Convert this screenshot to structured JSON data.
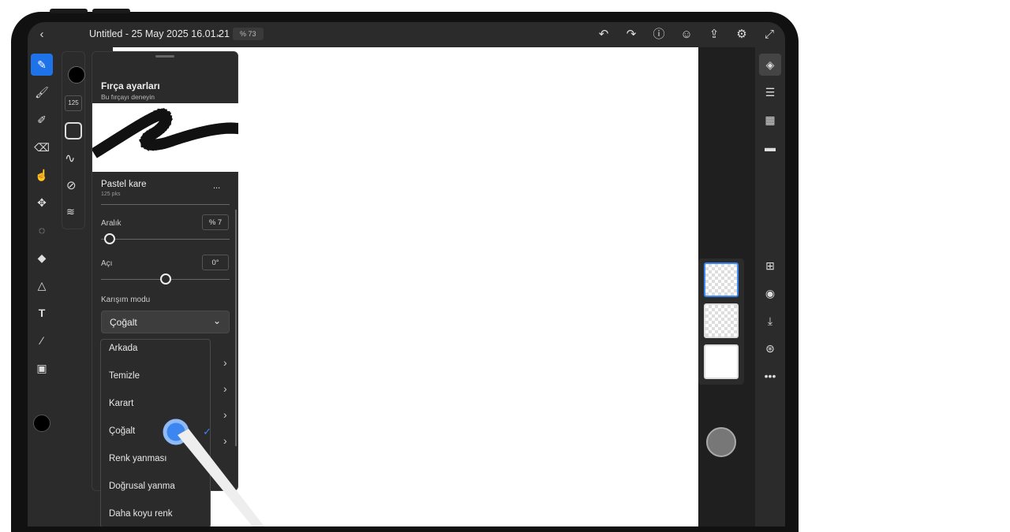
{
  "topbar": {
    "title": "Untitled - 25 May 2025 16.01.21",
    "zoom": "% 73"
  },
  "panel": {
    "title": "Fırça ayarları",
    "subtitle": "Bu fırçayı deneyin",
    "brush_name": "Pastel kare",
    "brush_size": "125 pks",
    "more": "...",
    "spacing_label": "Aralık",
    "spacing_value": "% 7",
    "spacing_fraction": 0.07,
    "angle_label": "Açı",
    "angle_value": "0°",
    "angle_fraction": 0.5,
    "blend_label": "Karışım modu",
    "blend_value": "Çoğalt"
  },
  "subtoolbar": {
    "size": "125"
  },
  "blend_menu": {
    "items": [
      "Arkada",
      "Temizle",
      "Karart",
      "Çoğalt",
      "Renk yanması",
      "Doğrusal yanma",
      "Daha koyu renk"
    ],
    "selected": "Çoğalt"
  },
  "colors": {
    "accent": "#1e73e8",
    "bg": "#2b2b2b"
  }
}
